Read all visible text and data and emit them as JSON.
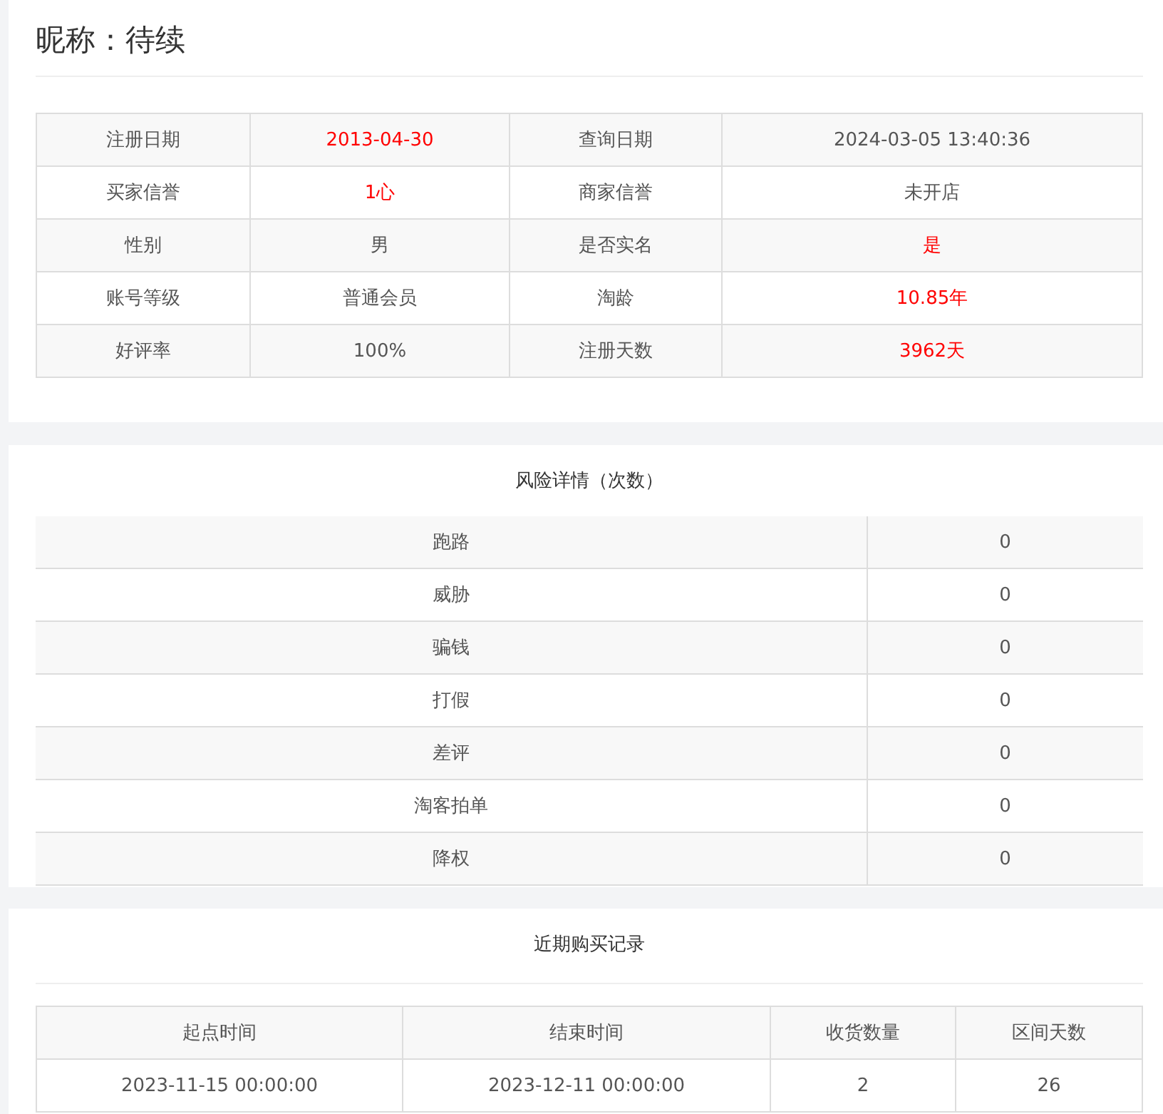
{
  "title": "昵称：待续",
  "info_rows": [
    {
      "cells": [
        {
          "text": "注册日期",
          "highlight": false
        },
        {
          "text": "2013-04-30",
          "highlight": true
        },
        {
          "text": "查询日期",
          "highlight": false
        },
        {
          "text": "2024-03-05 13:40:36",
          "highlight": false
        }
      ]
    },
    {
      "cells": [
        {
          "text": "买家信誉",
          "highlight": false
        },
        {
          "text": "1心",
          "highlight": true
        },
        {
          "text": "商家信誉",
          "highlight": false
        },
        {
          "text": "未开店",
          "highlight": false
        }
      ]
    },
    {
      "cells": [
        {
          "text": "性别",
          "highlight": false
        },
        {
          "text": "男",
          "highlight": false
        },
        {
          "text": "是否实名",
          "highlight": false
        },
        {
          "text": "是",
          "highlight": true
        }
      ]
    },
    {
      "cells": [
        {
          "text": "账号等级",
          "highlight": false
        },
        {
          "text": "普通会员",
          "highlight": false
        },
        {
          "text": "淘龄",
          "highlight": false
        },
        {
          "text": "10.85年",
          "highlight": true
        }
      ]
    },
    {
      "cells": [
        {
          "text": "好评率",
          "highlight": false
        },
        {
          "text": "100%",
          "highlight": false
        },
        {
          "text": "注册天数",
          "highlight": false
        },
        {
          "text": "3962天",
          "highlight": true
        }
      ]
    }
  ],
  "risk": {
    "title": "风险详情（次数）",
    "rows": [
      {
        "name": "跑路",
        "count": "0"
      },
      {
        "name": "威胁",
        "count": "0"
      },
      {
        "name": "骗钱",
        "count": "0"
      },
      {
        "name": "打假",
        "count": "0"
      },
      {
        "name": "差评",
        "count": "0"
      },
      {
        "name": "淘客拍单",
        "count": "0"
      },
      {
        "name": "降权",
        "count": "0"
      }
    ]
  },
  "purchases": {
    "title": "近期购买记录",
    "columns": [
      "起点时间",
      "结束时间",
      "收货数量",
      "区间天数"
    ],
    "rows": [
      [
        "2023-11-15 00:00:00",
        "2023-12-11 00:00:00",
        "2",
        "26"
      ]
    ]
  }
}
